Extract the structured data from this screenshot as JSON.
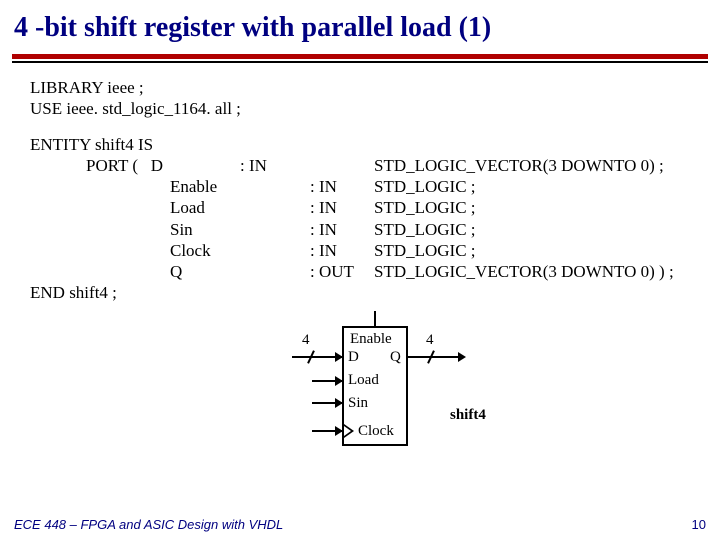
{
  "title": "4 -bit shift register with parallel load (1)",
  "code": {
    "line1": "LIBRARY ieee ;",
    "line2": "USE ieee. std_logic_1164. all ;",
    "entity": "ENTITY shift4 IS",
    "port_open": "PORT (",
    "ports": {
      "r0": {
        "name": "D",
        "dir": ": IN",
        "type": "STD_LOGIC_VECTOR(3 DOWNTO 0) ;"
      },
      "r1": {
        "name": "Enable",
        "dir": ": IN",
        "type": "STD_LOGIC ;"
      },
      "r2": {
        "name": "Load",
        "dir": ": IN",
        "type": "STD_LOGIC ;"
      },
      "r3": {
        "name": "Sin",
        "dir": ": IN",
        "type": "STD_LOGIC ;"
      },
      "r4": {
        "name": "Clock",
        "dir": ": IN",
        "type": "STD_LOGIC ;"
      },
      "r5": {
        "name": "Q",
        "dir": ": OUT",
        "type": "STD_LOGIC_VECTOR(3 DOWNTO 0) ) ;"
      }
    },
    "end": "END shift4 ;"
  },
  "diagram": {
    "enable": "Enable",
    "d": "D",
    "q": "Q",
    "load": "Load",
    "sin": "Sin",
    "clock": "Clock",
    "width_left": "4",
    "width_right": "4",
    "name": "shift4"
  },
  "footer": {
    "course": "ECE 448 – FPGA and ASIC Design with VHDL",
    "page": "10"
  }
}
